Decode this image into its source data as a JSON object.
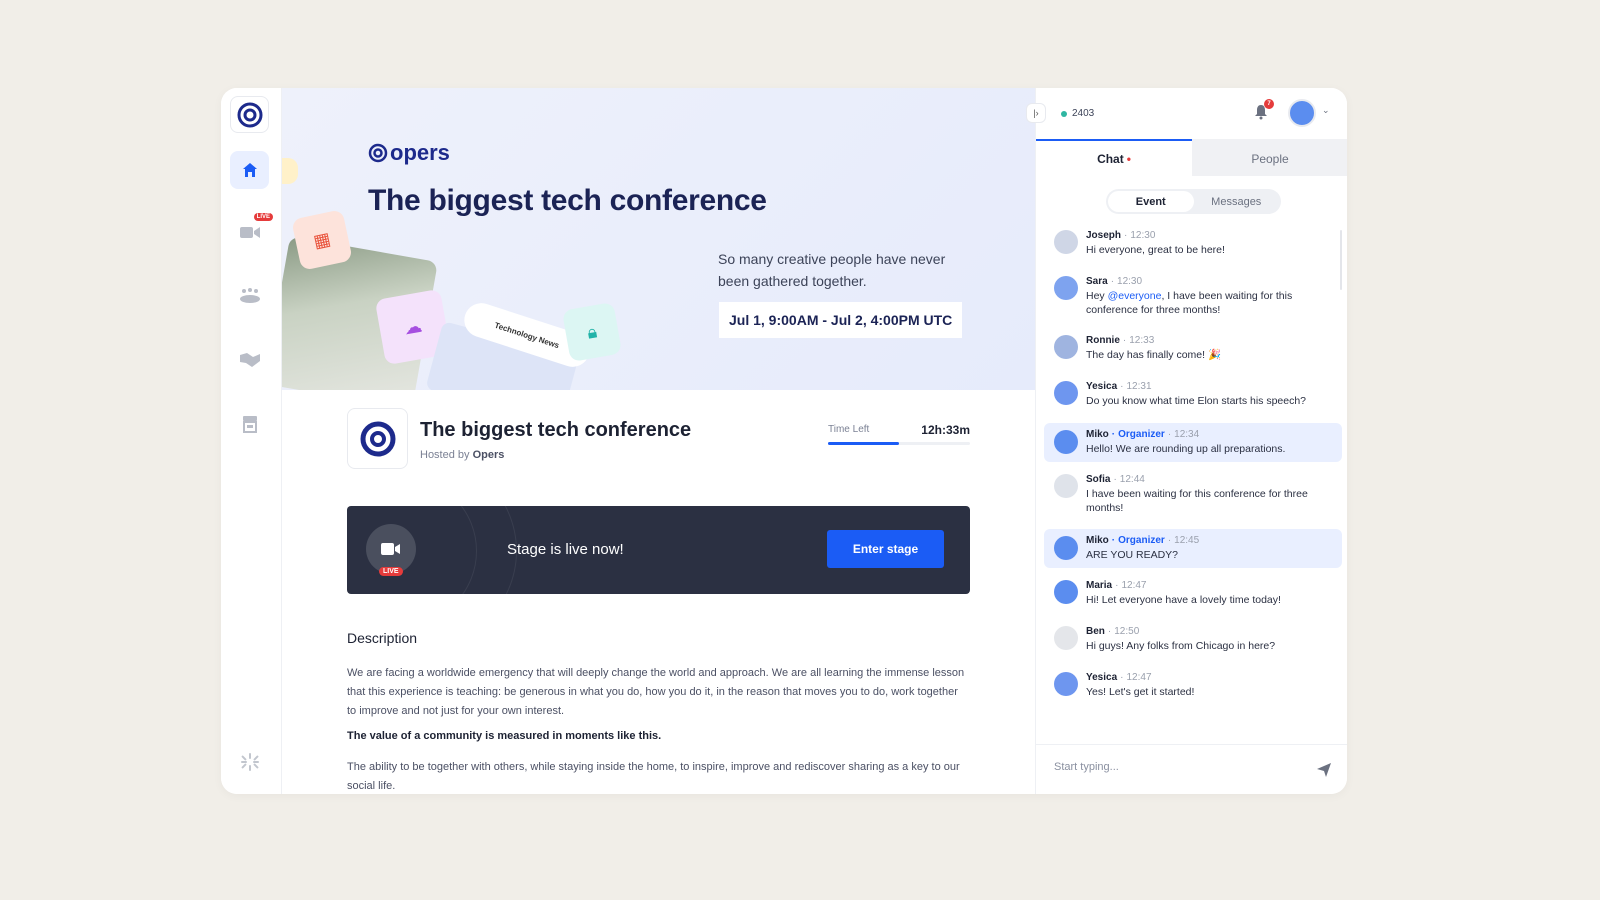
{
  "sidebar": {
    "items": [
      {
        "name": "home",
        "icon": "home-icon",
        "active": true
      },
      {
        "name": "stage",
        "icon": "video-camera-icon",
        "badge": "LIVE"
      },
      {
        "name": "sessions",
        "icon": "audience-icon"
      },
      {
        "name": "networking",
        "icon": "handshake-icon"
      },
      {
        "name": "expo",
        "icon": "booth-icon"
      }
    ]
  },
  "banner": {
    "brand": "opers",
    "title": "The biggest tech conference",
    "subtitle": "So many creative people have never been gathered together.",
    "date_range": "Jul 1, 9:00AM - Jul 2, 4:00PM UTC",
    "tech_news_label": "Technology News"
  },
  "event": {
    "title": "The biggest tech conference",
    "hosted_by_label": "Hosted by",
    "host": "Opers",
    "time_left_label": "Time Left",
    "time_left_value": "12h:33m",
    "time_left_progress_pct": 50
  },
  "stage": {
    "live_badge": "LIVE",
    "status_text": "Stage is live now!",
    "enter_button": "Enter stage"
  },
  "description": {
    "heading": "Description",
    "paragraph1": "We are facing a worldwide emergency that will deeply change the world and approach. We are all learning the immense lesson that this experience is teaching: be generous in what you do, how you do it, in the reason that moves you to do, work together to improve and not just for your own interest.",
    "highlight": "The value of a community is measured in moments like this.",
    "paragraph2": "The ability to be together with others, while staying inside the home, to inspire, improve and rediscover sharing as a key to our social life."
  },
  "chat": {
    "online_count": "2403",
    "notification_count": "7",
    "tabs": [
      {
        "label": "Chat",
        "active": true,
        "unread_dot": "•"
      },
      {
        "label": "People",
        "active": false
      }
    ],
    "segments": [
      {
        "label": "Event",
        "active": true
      },
      {
        "label": "Messages",
        "active": false
      }
    ],
    "messages": [
      {
        "name": "Joseph",
        "time": "12:30",
        "text": "Hi everyone, great to be here!",
        "avatar_color": "#cfd6e6"
      },
      {
        "name": "Sara",
        "time": "12:30",
        "text_before": "Hey ",
        "mention": "@everyone",
        "text_after": ", I have been waiting for this conference for three months!",
        "avatar_color": "#7ea3ef"
      },
      {
        "name": "Ronnie",
        "time": "12:33",
        "text": "The day has finally come! 🎉",
        "avatar_color": "#9fb4e0"
      },
      {
        "name": "Yesica",
        "time": "12:31",
        "text": "Do you know what time Elon starts his speech?",
        "avatar_color": "#6e96ef"
      },
      {
        "name": "Miko",
        "role": "Organizer",
        "time": "12:34",
        "text": "Hello! We are rounding up all preparations.",
        "avatar_color": "#5b8def",
        "organizer": true
      },
      {
        "name": "Sofia",
        "time": "12:44",
        "text": "I have been waiting for this conference for three months!",
        "avatar_color": "#dfe3ea"
      },
      {
        "name": "Miko",
        "role": "Organizer",
        "time": "12:45",
        "text": "ARE YOU READY?",
        "avatar_color": "#5b8def",
        "organizer": true
      },
      {
        "name": "Maria",
        "time": "12:47",
        "text": "Hi! Let everyone have a lovely time today!",
        "avatar_color": "#5b8def"
      },
      {
        "name": "Ben",
        "time": "12:50",
        "text": "Hi guys! Any folks from Chicago in here?",
        "avatar_color": "#e4e6ea"
      },
      {
        "name": "Yesica",
        "time": "12:47",
        "text": "Yes! Let's get it started!",
        "avatar_color": "#6e96ef"
      }
    ],
    "composer_placeholder": "Start typing..."
  },
  "colors": {
    "accent": "#1b5cf5",
    "brand": "#1d2a8c",
    "live": "#e53b3b",
    "online": "#2fb6a2",
    "stage_bg": "#2b3042"
  }
}
